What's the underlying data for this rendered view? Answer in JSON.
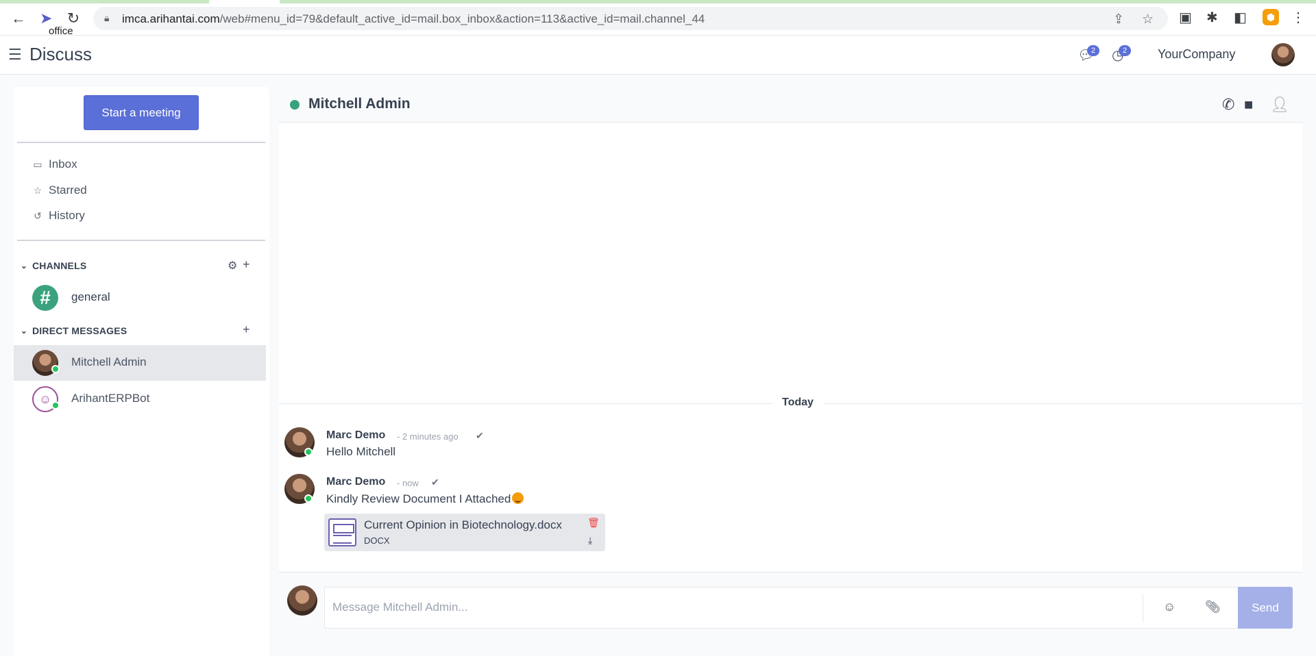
{
  "browser": {
    "url_host": "imca.arihantai.com",
    "url_rest": "/web#menu_id=79&default_active_id=mail.box_inbox&action=113&active_id=mail.channel_44",
    "tooltip": "office"
  },
  "header": {
    "app_title": "Discuss",
    "messages_counter": "2",
    "activities_counter": "2",
    "company": "YourCompany"
  },
  "sidebar": {
    "start_meeting": "Start a meeting",
    "mailboxes": [
      {
        "label": "Inbox",
        "icon": "inbox-icon"
      },
      {
        "label": "Starred",
        "icon": "star-icon"
      },
      {
        "label": "History",
        "icon": "history-icon"
      }
    ],
    "channels_header": "CHANNELS",
    "channels": [
      {
        "label": "general"
      }
    ],
    "dm_header": "DIRECT MESSAGES",
    "direct_messages": [
      {
        "label": "Mitchell Admin",
        "active": true
      },
      {
        "label": "ArihantERPBot",
        "active": false
      }
    ]
  },
  "thread": {
    "title": "Mitchell Admin",
    "date_separator": "Today",
    "messages": [
      {
        "author": "Marc Demo",
        "time": "- 2 minutes ago",
        "body": "Hello Mitchell"
      },
      {
        "author": "Marc Demo",
        "time": "- now",
        "body": "Kindly Review Document I Attached"
      }
    ],
    "attachment": {
      "name": "Current Opinion in Biotechnology.docx",
      "ext": "DOCX"
    }
  },
  "composer": {
    "placeholder": "Message Mitchell Admin...",
    "send_label": "Send"
  },
  "colors": {
    "primary": "#5b6fd8",
    "online": "#22c55e",
    "channel_avatar": "#3aa37e",
    "send_disabled": "#a5b0e8"
  }
}
